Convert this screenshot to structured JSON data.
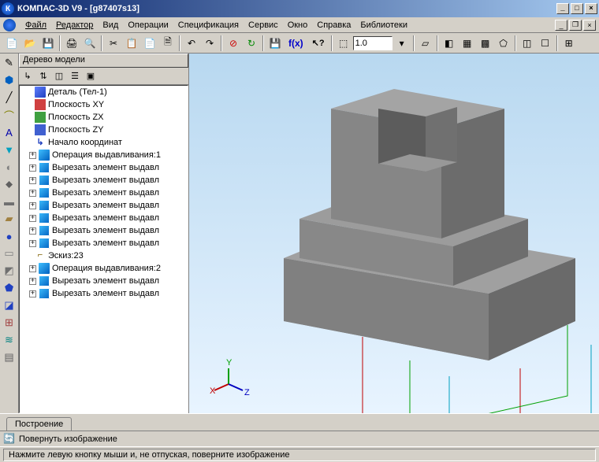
{
  "window": {
    "title": "КОМПАС-3D V9 - [g87407s13]"
  },
  "menu": [
    "Файл",
    "Редактор",
    "Вид",
    "Операции",
    "Спецификация",
    "Сервис",
    "Окно",
    "Справка",
    "Библиотеки"
  ],
  "toolbar1": {
    "buttons": [
      "new",
      "open",
      "save",
      "print",
      "preview",
      "cut",
      "copy",
      "paste",
      "props",
      "undo",
      "redo",
      "stop",
      "refresh",
      "save-doc",
      "fx",
      "help-arrow"
    ],
    "scale": "1.0"
  },
  "tree": {
    "title": "Дерево модели",
    "root": "Деталь (Тел-1)",
    "items": [
      {
        "icon": "plane-r",
        "label": "Плоскость XY",
        "exp": false
      },
      {
        "icon": "plane-g",
        "label": "Плоскость ZX",
        "exp": false
      },
      {
        "icon": "plane-b",
        "label": "Плоскость ZY",
        "exp": false
      },
      {
        "icon": "origin",
        "label": "Начало координат",
        "exp": false
      },
      {
        "icon": "extr",
        "label": "Операция выдавливания:1",
        "exp": true
      },
      {
        "icon": "cut",
        "label": "Вырезать элемент выдавл",
        "exp": true
      },
      {
        "icon": "cut",
        "label": "Вырезать элемент выдавл",
        "exp": true
      },
      {
        "icon": "cut",
        "label": "Вырезать элемент выдавл",
        "exp": true
      },
      {
        "icon": "cut",
        "label": "Вырезать элемент выдавл",
        "exp": true
      },
      {
        "icon": "cut",
        "label": "Вырезать элемент выдавл",
        "exp": true
      },
      {
        "icon": "cut",
        "label": "Вырезать элемент выдавл",
        "exp": true
      },
      {
        "icon": "cut",
        "label": "Вырезать элемент выдавл",
        "exp": true
      },
      {
        "icon": "sketch",
        "label": "Эскиз:23",
        "exp": false
      },
      {
        "icon": "extr",
        "label": "Операция выдавливания:2",
        "exp": true
      },
      {
        "icon": "cut",
        "label": "Вырезать элемент выдавл",
        "exp": true
      },
      {
        "icon": "cut",
        "label": "Вырезать элемент выдавл",
        "exp": true
      }
    ]
  },
  "axes": {
    "x": "X",
    "y": "Y",
    "z": "Z"
  },
  "tab": "Построение",
  "action": "Повернуть изображение",
  "status": "Нажмите левую кнопку мыши и, не отпуская, поверните изображение"
}
